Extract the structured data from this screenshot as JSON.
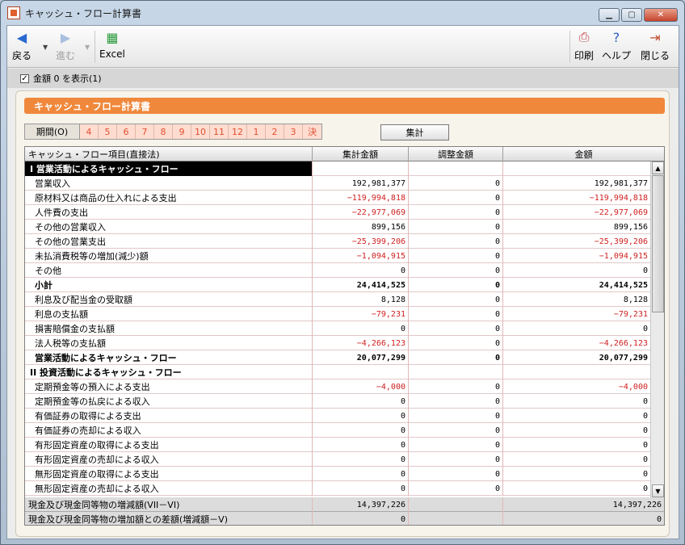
{
  "window": {
    "title": "キャッシュ・フロー計算書"
  },
  "toolbar": {
    "back": "戻る",
    "forward": "進む",
    "excel": "Excel",
    "print": "印刷",
    "help": "ヘルプ",
    "close": "閉じる"
  },
  "option": {
    "show_zero": "金額 0 を表示(1)"
  },
  "panel": {
    "title": "キャッシュ・フロー計算書"
  },
  "period": {
    "label": "期間(O)",
    "months": [
      "4",
      "5",
      "6",
      "7",
      "8",
      "9",
      "10",
      "11",
      "12",
      "1",
      "2",
      "3",
      "決"
    ]
  },
  "sum_button": "集計",
  "grid": {
    "headers": [
      "キャッシュ・フロー項目(直接法)",
      "集計金額",
      "調整金額",
      "金額"
    ],
    "rows": [
      {
        "type": "section",
        "name": "I 営業活動によるキャッシュ・フロー",
        "a": "",
        "b": "",
        "c": ""
      },
      {
        "name": "営業収入",
        "a": "192,981,377",
        "b": "0",
        "c": "192,981,377"
      },
      {
        "name": "原材料又は商品の仕入れによる支出",
        "a": "−119,994,818",
        "b": "0",
        "c": "−119,994,818",
        "neg": true
      },
      {
        "name": "人件費の支出",
        "a": "−22,977,069",
        "b": "0",
        "c": "−22,977,069",
        "neg": true
      },
      {
        "name": "その他の営業収入",
        "a": "899,156",
        "b": "0",
        "c": "899,156"
      },
      {
        "name": "その他の営業支出",
        "a": "−25,399,206",
        "b": "0",
        "c": "−25,399,206",
        "neg": true
      },
      {
        "name": "未払消費税等の増加(減少)額",
        "a": "−1,094,915",
        "b": "0",
        "c": "−1,094,915",
        "neg": true
      },
      {
        "name": "その他",
        "a": "0",
        "b": "0",
        "c": "0"
      },
      {
        "name": "小計",
        "a": "24,414,525",
        "b": "0",
        "c": "24,414,525",
        "bold": true
      },
      {
        "name": "利息及び配当金の受取額",
        "a": "8,128",
        "b": "0",
        "c": "8,128"
      },
      {
        "name": "利息の支払額",
        "a": "−79,231",
        "b": "0",
        "c": "−79,231",
        "neg": true
      },
      {
        "name": "損害賠償金の支払額",
        "a": "0",
        "b": "0",
        "c": "0"
      },
      {
        "name": "法人税等の支払額",
        "a": "−4,266,123",
        "b": "0",
        "c": "−4,266,123",
        "neg": true
      },
      {
        "name": "営業活動によるキャッシュ・フロー",
        "a": "20,077,299",
        "b": "0",
        "c": "20,077,299",
        "bold": true
      },
      {
        "type": "section2",
        "name": "II 投資活動によるキャッシュ・フロー",
        "a": "",
        "b": "",
        "c": ""
      },
      {
        "name": "定期預金等の預入による支出",
        "a": "−4,000",
        "b": "0",
        "c": "−4,000",
        "neg": true
      },
      {
        "name": "定期預金等の払戻による収入",
        "a": "0",
        "b": "0",
        "c": "0"
      },
      {
        "name": "有価証券の取得による支出",
        "a": "0",
        "b": "0",
        "c": "0"
      },
      {
        "name": "有価証券の売却による収入",
        "a": "0",
        "b": "0",
        "c": "0"
      },
      {
        "name": "有形固定資産の取得による支出",
        "a": "0",
        "b": "0",
        "c": "0"
      },
      {
        "name": "有形固定資産の売却による収入",
        "a": "0",
        "b": "0",
        "c": "0"
      },
      {
        "name": "無形固定資産の取得による支出",
        "a": "0",
        "b": "0",
        "c": "0"
      },
      {
        "name": "無形固定資産の売却による収入",
        "a": "0",
        "b": "0",
        "c": "0"
      }
    ],
    "footer": [
      {
        "name": "現金及び現金同等物の増減額(VII－VI)",
        "a": "14,397,226",
        "b": "",
        "c": "14,397,226"
      },
      {
        "name": "現金及び現金同等物の増加額との差額(増減額－V)",
        "a": "0",
        "b": "",
        "c": "0"
      }
    ]
  }
}
